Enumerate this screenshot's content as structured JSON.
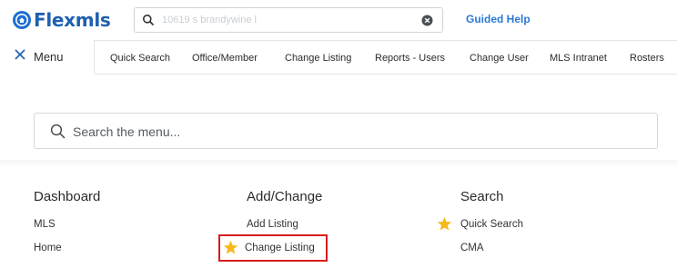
{
  "header": {
    "logo_text": "Flexmls",
    "search_placeholder": "10619 s brandywine l",
    "guided_help": "Guided Help"
  },
  "nav": {
    "menu_label": "Menu",
    "items": [
      {
        "label": "Quick Search"
      },
      {
        "label": "Office/Member"
      },
      {
        "label": "Change Listing"
      },
      {
        "label": "Reports - Users"
      },
      {
        "label": "Change User"
      },
      {
        "label": "MLS Intranet"
      },
      {
        "label": "Rosters"
      }
    ]
  },
  "menu_search": {
    "placeholder": "Search the menu..."
  },
  "columns": [
    {
      "title": "Dashboard",
      "links": [
        {
          "label": "MLS",
          "starred": false
        },
        {
          "label": "Home",
          "starred": false
        }
      ]
    },
    {
      "title": "Add/Change",
      "links": [
        {
          "label": "Add Listing",
          "starred": false
        },
        {
          "label": "Change Listing",
          "starred": true
        }
      ]
    },
    {
      "title": "Search",
      "links": [
        {
          "label": "Quick Search",
          "starred": true
        },
        {
          "label": "CMA",
          "starred": false
        }
      ]
    }
  ],
  "colors": {
    "brand_blue": "#1f5fb0",
    "link_blue": "#2b78d4",
    "star_yellow": "#f6b91b",
    "highlight_red": "#d81c1c"
  },
  "icons": [
    "flexmls-logo-icon",
    "search-icon",
    "clear-icon",
    "close-icon",
    "star-icon"
  ]
}
